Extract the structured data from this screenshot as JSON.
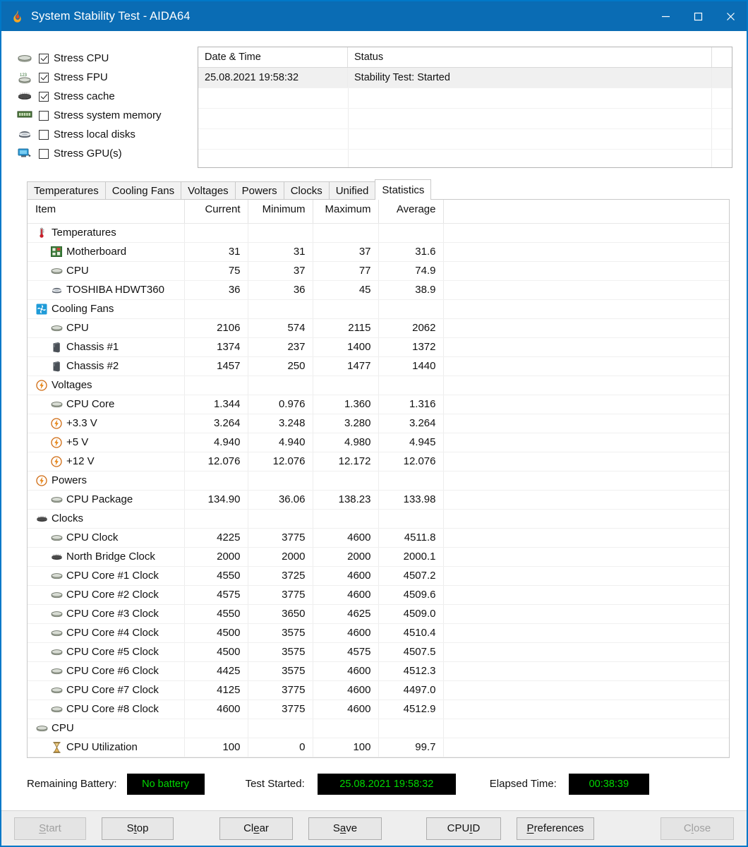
{
  "window": {
    "title": "System Stability Test - AIDA64",
    "app_icon": "flame-icon",
    "controls": {
      "minimize": "minimize-icon",
      "maximize": "maximize-icon",
      "close": "close-icon"
    },
    "accent_color": "#0a6cb4"
  },
  "stress_options": [
    {
      "label": "Stress CPU",
      "checked": true,
      "icon": "cpu-icon"
    },
    {
      "label": "Stress FPU",
      "checked": true,
      "icon": "fpu-icon"
    },
    {
      "label": "Stress cache",
      "checked": true,
      "icon": "cache-icon"
    },
    {
      "label": "Stress system memory",
      "checked": false,
      "icon": "memory-icon"
    },
    {
      "label": "Stress local disks",
      "checked": false,
      "icon": "disk-icon"
    },
    {
      "label": "Stress GPU(s)",
      "checked": false,
      "icon": "gpu-icon"
    }
  ],
  "log": {
    "columns": [
      "Date & Time",
      "Status"
    ],
    "rows": [
      {
        "datetime": "25.08.2021 19:58:32",
        "status": "Stability Test: Started"
      }
    ]
  },
  "tabs": [
    {
      "label": "Temperatures",
      "active": false
    },
    {
      "label": "Cooling Fans",
      "active": false
    },
    {
      "label": "Voltages",
      "active": false
    },
    {
      "label": "Powers",
      "active": false
    },
    {
      "label": "Clocks",
      "active": false
    },
    {
      "label": "Unified",
      "active": false
    },
    {
      "label": "Statistics",
      "active": true
    }
  ],
  "statistics": {
    "columns": [
      "Item",
      "Current",
      "Minimum",
      "Maximum",
      "Average"
    ],
    "rows": [
      {
        "type": "group",
        "icon": "thermometer-icon",
        "item": "Temperatures",
        "current": "",
        "minimum": "",
        "maximum": "",
        "average": ""
      },
      {
        "type": "leaf",
        "icon": "motherboard-icon",
        "item": "Motherboard",
        "current": "31",
        "minimum": "31",
        "maximum": "37",
        "average": "31.6"
      },
      {
        "type": "leaf",
        "icon": "cpu-icon",
        "item": "CPU",
        "current": "75",
        "minimum": "37",
        "maximum": "77",
        "average": "74.9"
      },
      {
        "type": "leaf",
        "icon": "hdd-icon",
        "item": "TOSHIBA HDWT360",
        "current": "36",
        "minimum": "36",
        "maximum": "45",
        "average": "38.9"
      },
      {
        "type": "group",
        "icon": "fan-icon",
        "item": "Cooling Fans",
        "current": "",
        "minimum": "",
        "maximum": "",
        "average": ""
      },
      {
        "type": "leaf",
        "icon": "cpu-icon",
        "item": "CPU",
        "current": "2106",
        "minimum": "574",
        "maximum": "2115",
        "average": "2062"
      },
      {
        "type": "leaf",
        "icon": "chassis-icon",
        "item": "Chassis #1",
        "current": "1374",
        "minimum": "237",
        "maximum": "1400",
        "average": "1372"
      },
      {
        "type": "leaf",
        "icon": "chassis-icon",
        "item": "Chassis #2",
        "current": "1457",
        "minimum": "250",
        "maximum": "1477",
        "average": "1440"
      },
      {
        "type": "group",
        "icon": "bolt-icon",
        "item": "Voltages",
        "current": "",
        "minimum": "",
        "maximum": "",
        "average": ""
      },
      {
        "type": "leaf",
        "icon": "cpu-icon",
        "item": "CPU Core",
        "current": "1.344",
        "minimum": "0.976",
        "maximum": "1.360",
        "average": "1.316"
      },
      {
        "type": "leaf",
        "icon": "bolt-icon",
        "item": "+3.3 V",
        "current": "3.264",
        "minimum": "3.248",
        "maximum": "3.280",
        "average": "3.264"
      },
      {
        "type": "leaf",
        "icon": "bolt-icon",
        "item": "+5 V",
        "current": "4.940",
        "minimum": "4.940",
        "maximum": "4.980",
        "average": "4.945"
      },
      {
        "type": "leaf",
        "icon": "bolt-icon",
        "item": "+12 V",
        "current": "12.076",
        "minimum": "12.076",
        "maximum": "12.172",
        "average": "12.076"
      },
      {
        "type": "group",
        "icon": "bolt-icon",
        "item": "Powers",
        "current": "",
        "minimum": "",
        "maximum": "",
        "average": ""
      },
      {
        "type": "leaf",
        "icon": "cpu-icon",
        "item": "CPU Package",
        "current": "134.90",
        "minimum": "36.06",
        "maximum": "138.23",
        "average": "133.98"
      },
      {
        "type": "group",
        "icon": "chip-icon",
        "item": "Clocks",
        "current": "",
        "minimum": "",
        "maximum": "",
        "average": ""
      },
      {
        "type": "leaf",
        "icon": "cpu-icon",
        "item": "CPU Clock",
        "current": "4225",
        "minimum": "3775",
        "maximum": "4600",
        "average": "4511.8"
      },
      {
        "type": "leaf",
        "icon": "chip-icon",
        "item": "North Bridge Clock",
        "current": "2000",
        "minimum": "2000",
        "maximum": "2000",
        "average": "2000.1"
      },
      {
        "type": "leaf",
        "icon": "cpu-icon",
        "item": "CPU Core #1 Clock",
        "current": "4550",
        "minimum": "3725",
        "maximum": "4600",
        "average": "4507.2"
      },
      {
        "type": "leaf",
        "icon": "cpu-icon",
        "item": "CPU Core #2 Clock",
        "current": "4575",
        "minimum": "3775",
        "maximum": "4600",
        "average": "4509.6"
      },
      {
        "type": "leaf",
        "icon": "cpu-icon",
        "item": "CPU Core #3 Clock",
        "current": "4550",
        "minimum": "3650",
        "maximum": "4625",
        "average": "4509.0"
      },
      {
        "type": "leaf",
        "icon": "cpu-icon",
        "item": "CPU Core #4 Clock",
        "current": "4500",
        "minimum": "3575",
        "maximum": "4600",
        "average": "4510.4"
      },
      {
        "type": "leaf",
        "icon": "cpu-icon",
        "item": "CPU Core #5 Clock",
        "current": "4500",
        "minimum": "3575",
        "maximum": "4575",
        "average": "4507.5"
      },
      {
        "type": "leaf",
        "icon": "cpu-icon",
        "item": "CPU Core #6 Clock",
        "current": "4425",
        "minimum": "3575",
        "maximum": "4600",
        "average": "4512.3"
      },
      {
        "type": "leaf",
        "icon": "cpu-icon",
        "item": "CPU Core #7 Clock",
        "current": "4125",
        "minimum": "3775",
        "maximum": "4600",
        "average": "4497.0"
      },
      {
        "type": "leaf",
        "icon": "cpu-icon",
        "item": "CPU Core #8 Clock",
        "current": "4600",
        "minimum": "3775",
        "maximum": "4600",
        "average": "4512.9"
      },
      {
        "type": "group",
        "icon": "cpu-icon",
        "item": "CPU",
        "current": "",
        "minimum": "",
        "maximum": "",
        "average": ""
      },
      {
        "type": "leaf",
        "icon": "hourglass-icon",
        "item": "CPU Utilization",
        "current": "100",
        "minimum": "0",
        "maximum": "100",
        "average": "99.7"
      }
    ]
  },
  "status": {
    "battery_label": "Remaining Battery:",
    "battery_value": "No battery",
    "started_label": "Test Started:",
    "started_value": "25.08.2021 19:58:32",
    "elapsed_label": "Elapsed Time:",
    "elapsed_value": "00:38:39",
    "value_text_color": "#00d900",
    "value_bg_color": "#000000"
  },
  "footer": {
    "buttons": [
      {
        "label": "Start",
        "accel": 0,
        "disabled": true,
        "name": "start-button"
      },
      {
        "label": "Stop",
        "accel": 1,
        "disabled": false,
        "name": "stop-button"
      },
      {
        "label": "Clear",
        "accel": 2,
        "disabled": false,
        "name": "clear-button"
      },
      {
        "label": "Save",
        "accel": 1,
        "disabled": false,
        "name": "save-button"
      },
      {
        "label": "CPUID",
        "accel": 3,
        "disabled": false,
        "name": "cpuid-button"
      },
      {
        "label": "Preferences",
        "accel": 0,
        "disabled": false,
        "name": "preferences-button"
      },
      {
        "label": "Close",
        "accel": 1,
        "disabled": true,
        "name": "close-button"
      }
    ]
  }
}
